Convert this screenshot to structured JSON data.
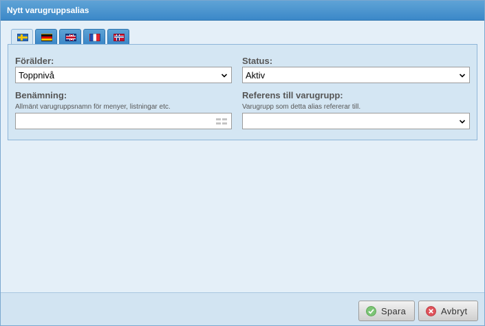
{
  "dialog": {
    "title": "Nytt varugruppsalias"
  },
  "language_tabs": [
    {
      "flag": "sweden-flag-icon",
      "active": true
    },
    {
      "flag": "germany-flag-icon",
      "active": false
    },
    {
      "flag": "uk-flag-icon",
      "active": false
    },
    {
      "flag": "france-flag-icon",
      "active": false
    },
    {
      "flag": "norway-flag-icon",
      "active": false
    }
  ],
  "form": {
    "parent": {
      "label": "Förälder:",
      "value": "Toppnivå"
    },
    "status": {
      "label": "Status:",
      "value": "Aktiv"
    },
    "name": {
      "label": "Benämning:",
      "hint": "Allmänt varugruppsnamn för menyer, listningar etc.",
      "value": ""
    },
    "reference": {
      "label": "Referens till varugrupp:",
      "hint": "Varugrupp som detta alias refererar till.",
      "value": ""
    }
  },
  "footer": {
    "save_label": "Spara",
    "cancel_label": "Avbryt"
  },
  "colors": {
    "titlebar": "#3b88c8",
    "save_icon": "#7cc576",
    "cancel_icon": "#e0535b"
  }
}
